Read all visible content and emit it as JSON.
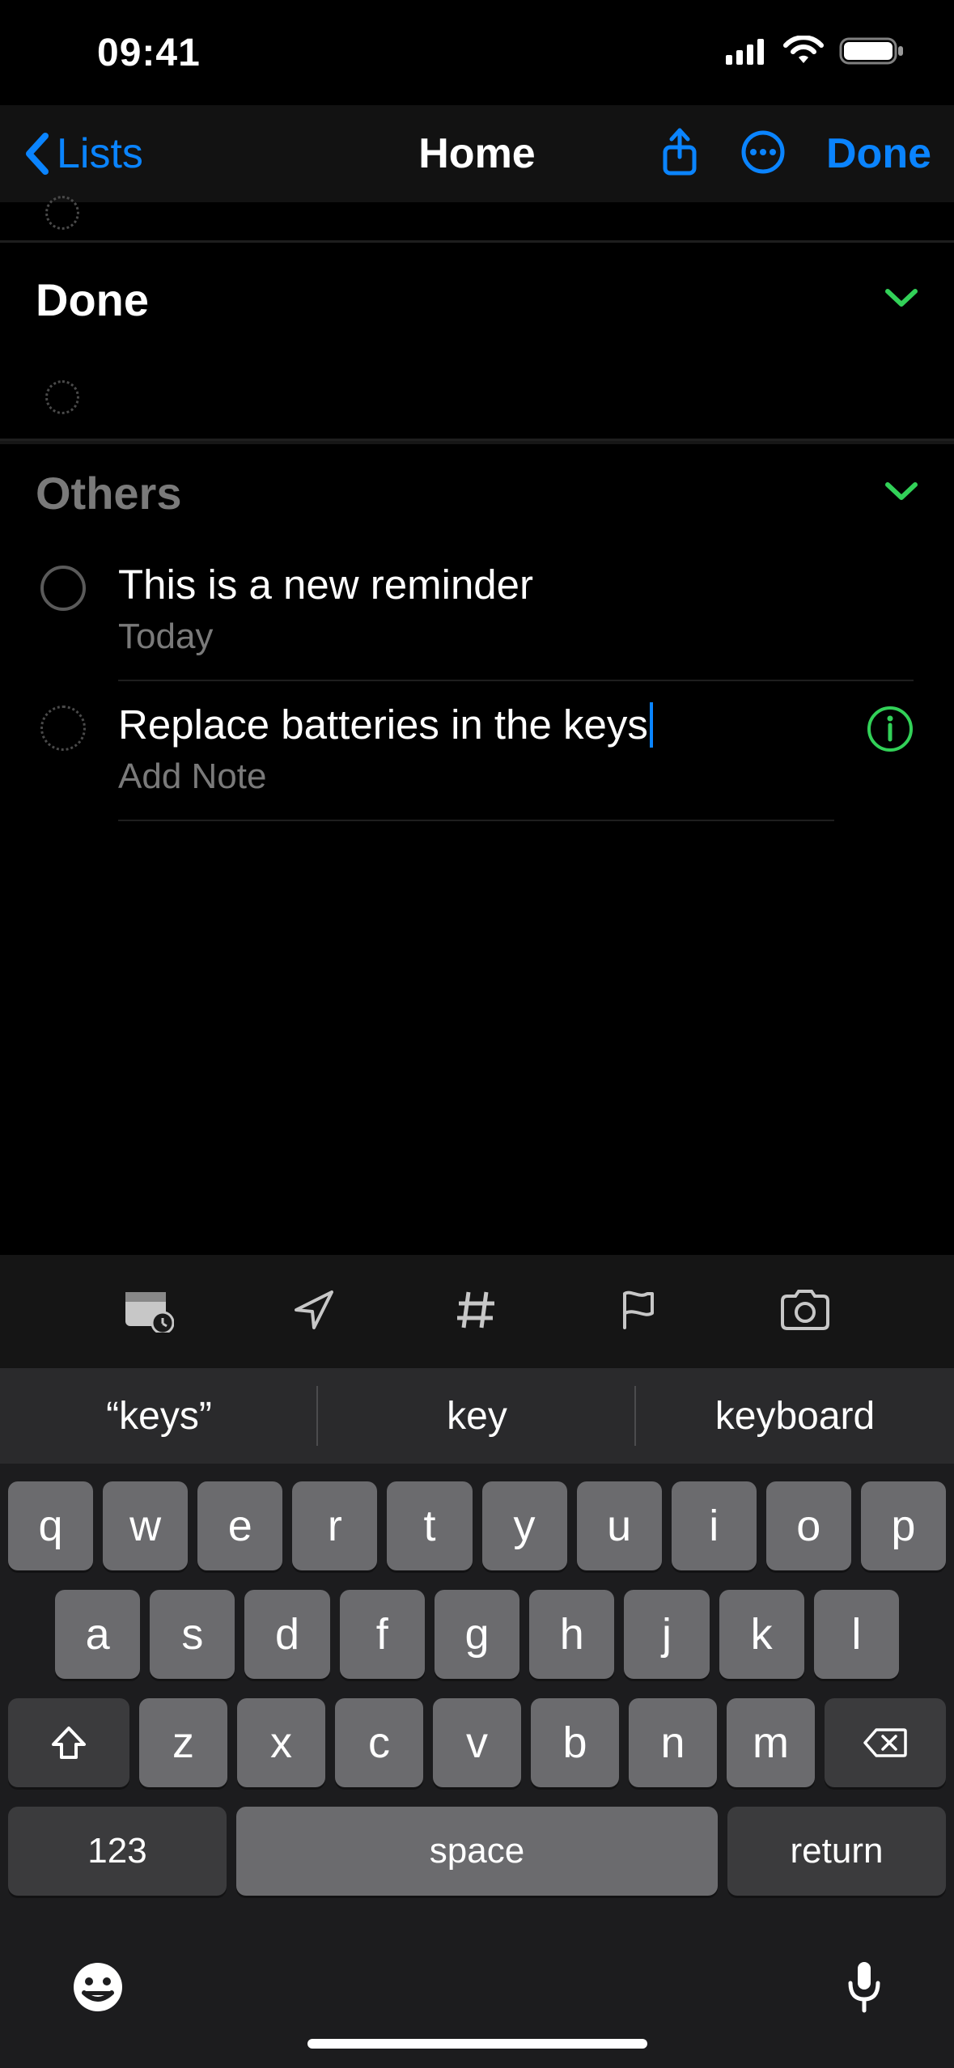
{
  "status": {
    "time": "09:41"
  },
  "nav": {
    "back_label": "Lists",
    "title": "Home",
    "done_label": "Done"
  },
  "sections": {
    "done": {
      "title": "Done"
    },
    "others": {
      "title": "Others",
      "items": [
        {
          "title": "This is a new reminder",
          "subtitle": "Today"
        },
        {
          "title": "Replace batteries in the keys",
          "subtitle_placeholder": "Add Note"
        }
      ]
    }
  },
  "quick_toolbar": [
    "calendar-icon",
    "location-icon",
    "tag-icon",
    "flag-icon",
    "camera-icon"
  ],
  "suggestions": [
    "“keys”",
    "key",
    "keyboard"
  ],
  "keyboard": {
    "row1": [
      "q",
      "w",
      "e",
      "r",
      "t",
      "y",
      "u",
      "i",
      "o",
      "p"
    ],
    "row2": [
      "a",
      "s",
      "d",
      "f",
      "g",
      "h",
      "j",
      "k",
      "l"
    ],
    "row3": [
      "z",
      "x",
      "c",
      "v",
      "b",
      "n",
      "m"
    ],
    "num_label": "123",
    "space_label": "space",
    "return_label": "return"
  }
}
